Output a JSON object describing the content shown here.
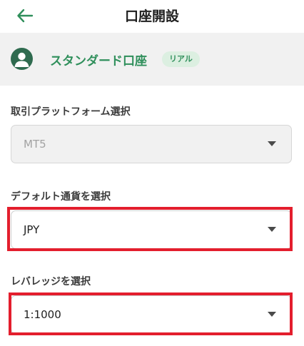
{
  "header": {
    "title": "口座開設",
    "back_icon": "arrow-left-icon",
    "back_icon_color": "#2f8f5b"
  },
  "account": {
    "icon": "user-circle-icon",
    "name": "スタンダード口座",
    "badge": "リアル",
    "accent_color": "#2f8f5b"
  },
  "platform": {
    "label": "取引プラットフォーム選択",
    "value": "MT5",
    "disabled": true
  },
  "currency": {
    "label": "デフォルト通貨を選択",
    "value": "JPY"
  },
  "leverage": {
    "label": "レバレッジを選択",
    "value": "1:1000"
  },
  "annotation": {
    "highlight_color": "#e31e2d"
  }
}
